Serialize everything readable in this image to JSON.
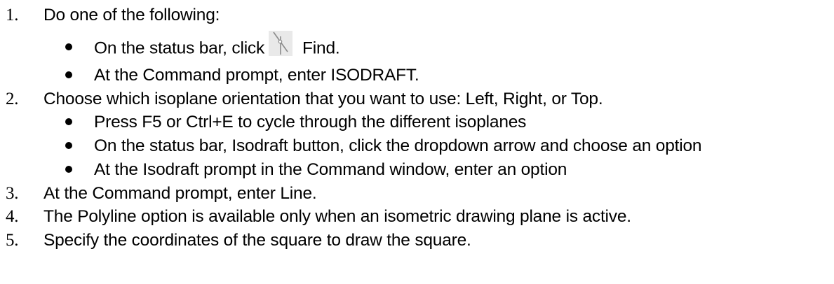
{
  "steps": [
    {
      "number": "1.",
      "text": "Do one of the following:",
      "bullets": [
        {
          "before_icon": "On the status bar, click",
          "icon": "isodraft-icon",
          "after_icon": "Find."
        },
        {
          "text": "At the Command prompt, enter ISODRAFT."
        }
      ]
    },
    {
      "number": "2.",
      "text": "Choose which isoplane orientation that you want to use: Left, Right, or Top.",
      "bullets": [
        {
          "text": "Press F5 or Ctrl+E to cycle through the different isoplanes"
        },
        {
          "text": "On the status bar, Isodraft button, click the dropdown arrow and choose an option"
        },
        {
          "text": "At the Isodraft prompt in the Command window, enter an option"
        }
      ]
    },
    {
      "number": "3.",
      "text": "At the Command prompt, enter Line."
    },
    {
      "number": "4.",
      "text": "The Polyline option is available only when an isometric drawing plane is active."
    },
    {
      "number": "5.",
      "text": "Specify the coordinates of the square to draw the square."
    }
  ]
}
